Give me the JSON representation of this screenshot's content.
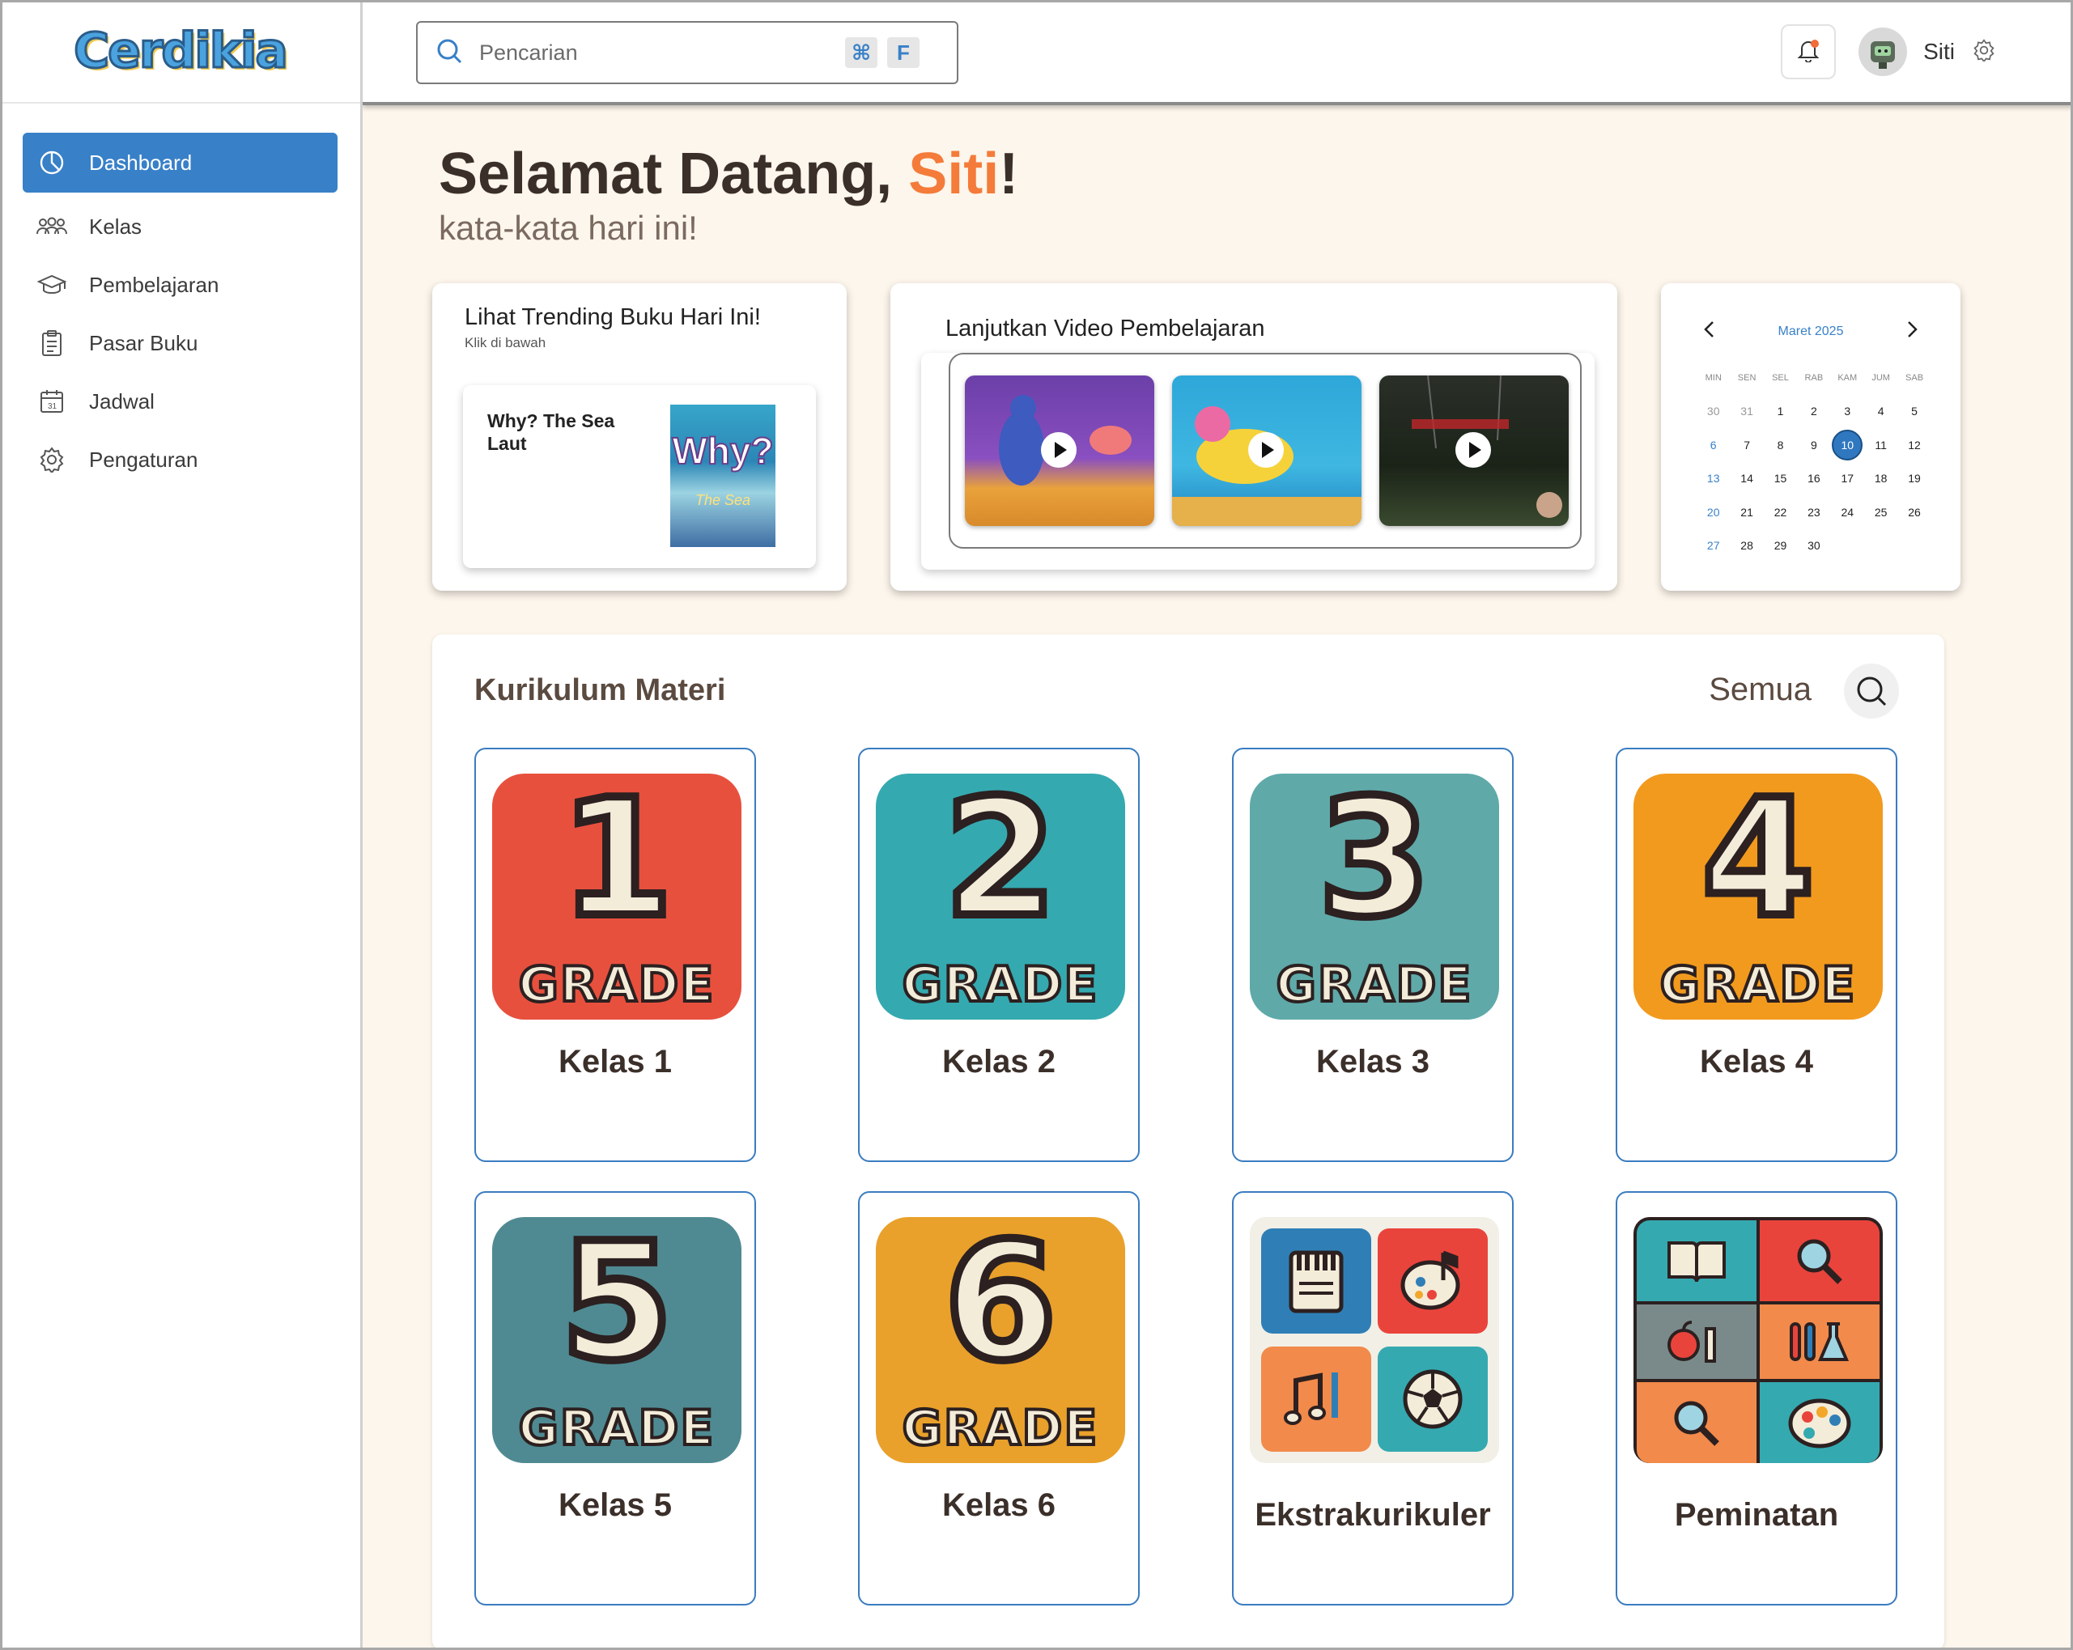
{
  "app": {
    "logo_text": "Cerdikia"
  },
  "sidebar": {
    "items": [
      {
        "label": "Dashboard",
        "icon": "dashboard-icon",
        "active": true
      },
      {
        "label": "Kelas",
        "icon": "users-icon"
      },
      {
        "label": "Pembelajaran",
        "icon": "graduation-cap-icon"
      },
      {
        "label": "Pasar Buku",
        "icon": "clipboard-icon"
      },
      {
        "label": "Jadwal",
        "icon": "calendar-icon"
      },
      {
        "label": "Pengaturan",
        "icon": "gear-icon"
      }
    ]
  },
  "header": {
    "search_placeholder": "Pencarian",
    "shortcut_key1": "⌘",
    "shortcut_key2": "F",
    "user_name": "Siti"
  },
  "welcome": {
    "greeting": "Selamat Datang, ",
    "name": "Siti",
    "exclaim": "!",
    "subtitle": "kata-kata hari ini!"
  },
  "trending": {
    "title": "Lihat Trending Buku Hari Ini!",
    "subtitle": "Klik di bawah",
    "book_title": "Why? The Sea Laut",
    "cover_title": "Why?",
    "cover_subtitle": "The Sea"
  },
  "videos": {
    "title": "Lanjutkan Video Pembelajaran",
    "items": [
      {
        "label": "video-1"
      },
      {
        "label": "video-2"
      },
      {
        "label": "video-3"
      }
    ]
  },
  "calendar": {
    "month": "Maret 2025",
    "weekdays": [
      "MIN",
      "SEN",
      "SEL",
      "RAB",
      "KAM",
      "JUM",
      "SAB"
    ],
    "weeks": [
      [
        "30",
        "31",
        "1",
        "2",
        "3",
        "4",
        "5"
      ],
      [
        "6",
        "7",
        "8",
        "9",
        "10",
        "11",
        "12"
      ],
      [
        "13",
        "14",
        "15",
        "16",
        "17",
        "18",
        "19"
      ],
      [
        "20",
        "21",
        "22",
        "23",
        "24",
        "25",
        "26"
      ],
      [
        "27",
        "28",
        "29",
        "30",
        "",
        "",
        ""
      ]
    ],
    "selected": "10",
    "accent": "#3880c8"
  },
  "curriculum": {
    "title": "Kurikulum Materi",
    "filter_label": "Semua",
    "cards": [
      {
        "label": "Kelas 1",
        "number": "1",
        "badge": "GRADE",
        "color": "#e8503e"
      },
      {
        "label": "Kelas 2",
        "number": "2",
        "badge": "GRADE",
        "color": "#35a9b0"
      },
      {
        "label": "Kelas 3",
        "number": "3",
        "badge": "GRADE",
        "color": "#5fa9a9"
      },
      {
        "label": "Kelas 4",
        "number": "4",
        "badge": "GRADE",
        "color": "#f29a1e"
      },
      {
        "label": "Kelas 5",
        "number": "5",
        "badge": "GRADE",
        "color": "#4f8a92"
      },
      {
        "label": "Kelas 6",
        "number": "6",
        "badge": "GRADE",
        "color": "#e9a12b"
      },
      {
        "label": "Ekstrakurikuler",
        "icons": [
          "piano-icon",
          "palette-icon",
          "music-note-icon",
          "soccer-ball-icon"
        ]
      },
      {
        "label": "Peminatan",
        "icons": [
          "book-icon",
          "magnifier-icon",
          "apple-icon",
          "lab-icon",
          "magnifier-icon",
          "palette-icon"
        ]
      }
    ]
  },
  "colors": {
    "accent": "#3880c8",
    "highlight": "#f47b3a",
    "background": "#fdf6ec"
  }
}
